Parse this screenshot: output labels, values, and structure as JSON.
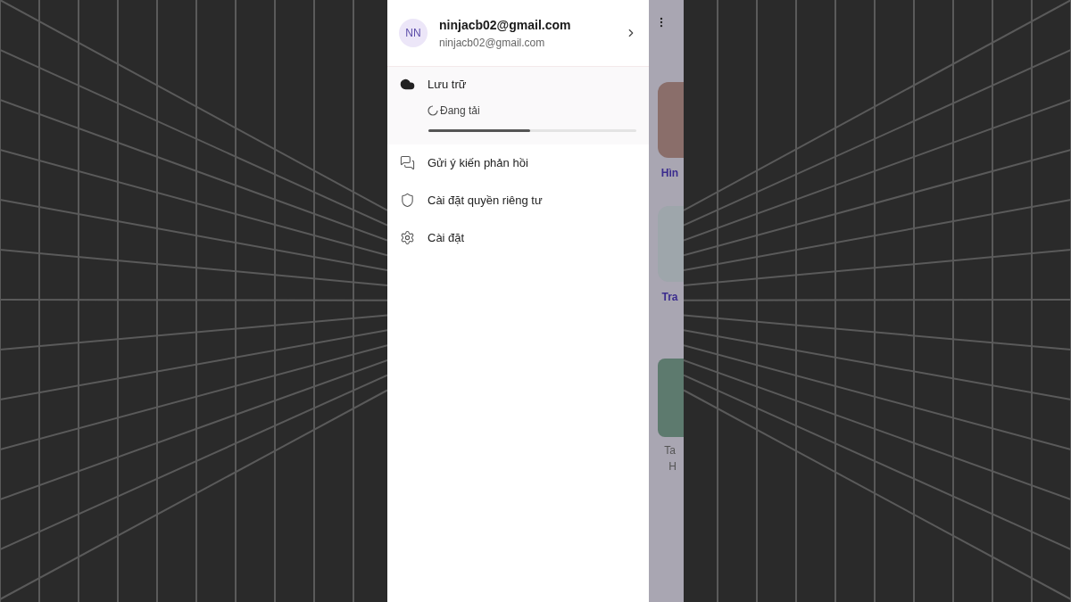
{
  "account": {
    "avatar_initials": "NN",
    "name": "ninjacb02@gmail.com",
    "email": "ninjacb02@gmail.com"
  },
  "storage": {
    "label": "Lưu trữ",
    "status": "Đang tải",
    "level": 0.49
  },
  "menu": [
    {
      "kind": "feedback",
      "label": "Gửi ý kiến phản hồi"
    },
    {
      "kind": "privacy",
      "label": "Cài đặt quyền riêng tư"
    },
    {
      "kind": "settings",
      "label": "Cài đặt"
    }
  ],
  "background_app": {
    "labels": [
      {
        "text": "Hìn",
        "accent": true
      },
      {
        "text": "Tra",
        "accent": true
      },
      {
        "text": "Ta",
        "accent": false
      },
      {
        "text": "H",
        "accent": false
      }
    ]
  }
}
